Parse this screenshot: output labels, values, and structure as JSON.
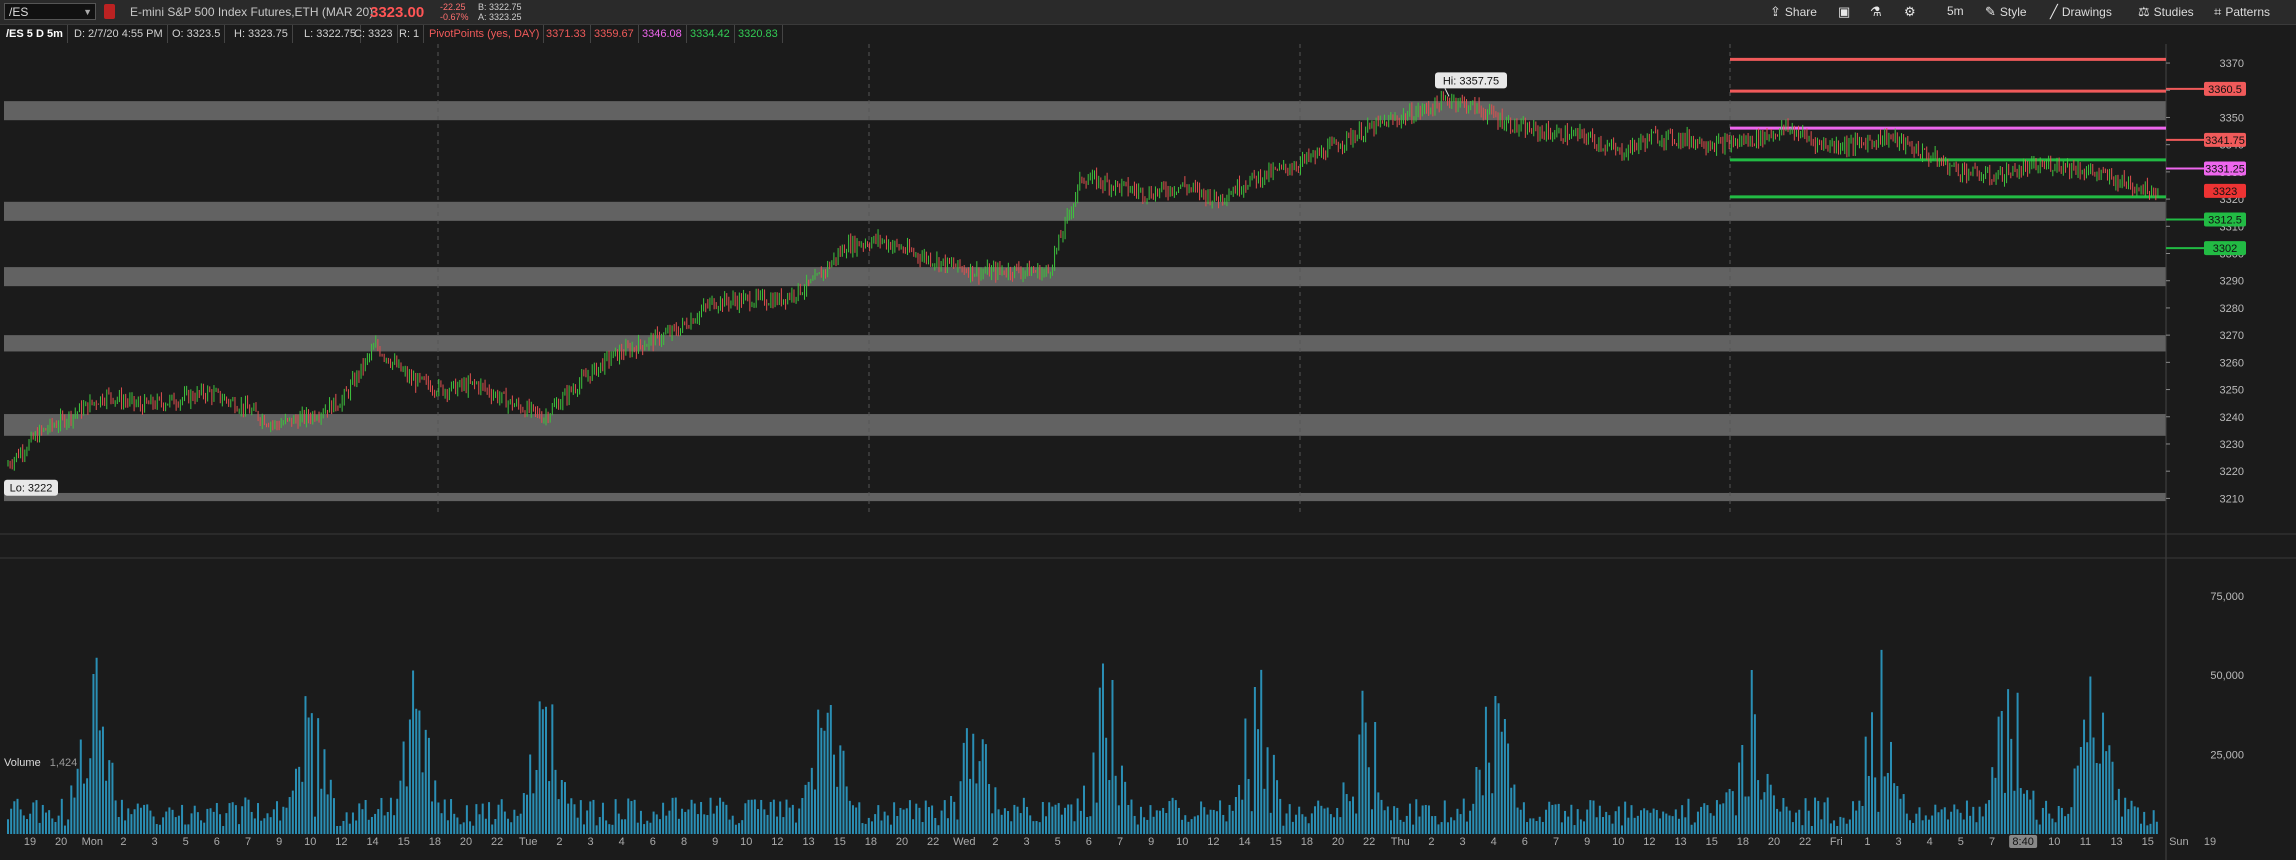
{
  "toolbar": {
    "symbol": "/ES",
    "description": "E-mini S&P 500 Index Futures,ETH (MAR 20)",
    "last_price": "3323.00",
    "net_change": "-22.25",
    "pct_change": "-0.67%",
    "bid": "B: 3322.75",
    "ask": "A: 3323.25",
    "share_label": "Share",
    "timeframe_label": "5m",
    "style_label": "Style",
    "drawings_label": "Drawings",
    "studies_label": "Studies",
    "patterns_label": "Patterns"
  },
  "infobar": {
    "chart_name": "/ES 5 D 5m",
    "date": "D: 2/7/20 4:55 PM",
    "open": "O: 3323.5",
    "high": "H: 3323.75",
    "low": "L: 3322.75",
    "close": "C: 3323",
    "range": "R: 1",
    "study_name": "PivotPoints (yes, DAY)",
    "pivots": [
      "3371.33",
      "3359.67",
      "3346.08",
      "3334.42",
      "3320.83"
    ]
  },
  "price_axis": {
    "ticks": [
      "3370",
      "3360",
      "3350",
      "3340",
      "3330",
      "3320",
      "3310",
      "3300",
      "3290",
      "3280",
      "3270",
      "3260",
      "3250",
      "3240",
      "3230",
      "3220",
      "3210"
    ]
  },
  "price_labels": [
    {
      "text": "3360.5",
      "value": 3360.5,
      "color": "#f05a5a"
    },
    {
      "text": "3341.75",
      "value": 3341.75,
      "color": "#f05a5a"
    },
    {
      "text": "3331.25",
      "value": 3331.25,
      "color": "#ee66ee"
    },
    {
      "text": "3323",
      "value": 3323,
      "color": "#ee3333"
    },
    {
      "text": "3312.5",
      "value": 3312.5,
      "color": "#22bb44"
    },
    {
      "text": "3302",
      "value": 3302,
      "color": "#22bb44"
    }
  ],
  "annotations": {
    "high_label": "Hi: 3357.75",
    "low_label": "Lo: 3222"
  },
  "volume": {
    "label": "Volume",
    "value": "1,424",
    "ticks": [
      "75,000",
      "50,000",
      "25,000"
    ]
  },
  "time_axis": {
    "labels": [
      "19",
      "20",
      "Mon",
      "2",
      "3",
      "5",
      "6",
      "7",
      "9",
      "10",
      "12",
      "14",
      "15",
      "18",
      "20",
      "22",
      "Tue",
      "2",
      "3",
      "4",
      "6",
      "8",
      "9",
      "10",
      "12",
      "13",
      "15",
      "18",
      "20",
      "22",
      "Wed",
      "2",
      "3",
      "5",
      "6",
      "7",
      "9",
      "10",
      "12",
      "14",
      "15",
      "18",
      "20",
      "22",
      "Thu",
      "2",
      "3",
      "4",
      "6",
      "7",
      "9",
      "10",
      "12",
      "13",
      "15",
      "18",
      "20",
      "22",
      "Fri",
      "1",
      "3",
      "4",
      "5",
      "7",
      "8:40",
      "10",
      "11",
      "13",
      "15",
      "Sun",
      "19"
    ]
  },
  "colors": {
    "background": "#1b1b1b",
    "zone": "#6e6e6e",
    "pivot_red": "#f05a5a",
    "pivot_magenta": "#ee66ee",
    "pivot_green": "#22bb44",
    "candle_up": "#3ec43e",
    "candle_down": "#e05050",
    "volume": "#2a8fb5"
  },
  "chart_data": {
    "type": "candlestick",
    "title": "/ES 5 D 5m",
    "ylim": [
      3205,
      3377
    ],
    "y_ticks": [
      3370,
      3360,
      3350,
      3340,
      3330,
      3320,
      3310,
      3300,
      3290,
      3280,
      3270,
      3260,
      3250,
      3240,
      3230,
      3220,
      3210
    ],
    "price_path": [
      [
        0,
        3222
      ],
      [
        1,
        3234
      ],
      [
        2,
        3241
      ],
      [
        3,
        3248
      ],
      [
        4,
        3244
      ],
      [
        5,
        3246
      ],
      [
        6,
        3249
      ],
      [
        7,
        3244
      ],
      [
        8,
        3237
      ],
      [
        9,
        3240
      ],
      [
        10,
        3246
      ],
      [
        11,
        3266
      ],
      [
        12,
        3254
      ],
      [
        13,
        3250
      ],
      [
        14,
        3252
      ],
      [
        15,
        3245
      ],
      [
        16,
        3240
      ],
      [
        17,
        3252
      ],
      [
        18,
        3262
      ],
      [
        19,
        3267
      ],
      [
        20,
        3272
      ],
      [
        21,
        3282
      ],
      [
        22,
        3283
      ],
      [
        23,
        3283
      ],
      [
        24,
        3289
      ],
      [
        25,
        3303
      ],
      [
        26,
        3305
      ],
      [
        27,
        3300
      ],
      [
        28,
        3296
      ],
      [
        29,
        3293
      ],
      [
        30,
        3294
      ],
      [
        31,
        3293
      ],
      [
        32,
        3328
      ],
      [
        33,
        3325
      ],
      [
        34,
        3322
      ],
      [
        35,
        3325
      ],
      [
        36,
        3320
      ],
      [
        37,
        3327
      ],
      [
        38,
        3331
      ],
      [
        39,
        3336
      ],
      [
        40,
        3343
      ],
      [
        41,
        3348
      ],
      [
        42,
        3352
      ],
      [
        43,
        3357
      ],
      [
        44,
        3352
      ],
      [
        45,
        3346
      ],
      [
        46,
        3344
      ],
      [
        47,
        3343
      ],
      [
        48,
        3337
      ],
      [
        49,
        3343
      ],
      [
        50,
        3342
      ],
      [
        51,
        3340
      ],
      [
        52,
        3342
      ],
      [
        53,
        3346
      ],
      [
        54,
        3340
      ],
      [
        55,
        3340
      ],
      [
        56,
        3343
      ],
      [
        57,
        3337
      ],
      [
        58,
        3331
      ],
      [
        59,
        3328
      ],
      [
        60,
        3331
      ],
      [
        61,
        3333
      ],
      [
        62,
        3330
      ],
      [
        63,
        3326
      ],
      [
        64,
        3323
      ]
    ],
    "zones": [
      [
        3349,
        3356
      ],
      [
        3312,
        3319
      ],
      [
        3288,
        3295
      ],
      [
        3264,
        3270
      ],
      [
        3233,
        3241
      ],
      [
        3209,
        3212
      ]
    ],
    "pivot_lines": [
      {
        "value": 3371.33,
        "color": "red"
      },
      {
        "value": 3359.67,
        "color": "red"
      },
      {
        "value": 3346.08,
        "color": "magenta"
      },
      {
        "value": 3334.42,
        "color": "green"
      },
      {
        "value": 3320.83,
        "color": "green"
      }
    ],
    "right_levels": [
      3360.5,
      3341.75,
      3331.25,
      3312.5,
      3302
    ],
    "high": 3357.75,
    "low": 3222,
    "volume_ylim": [
      0,
      85000
    ]
  }
}
